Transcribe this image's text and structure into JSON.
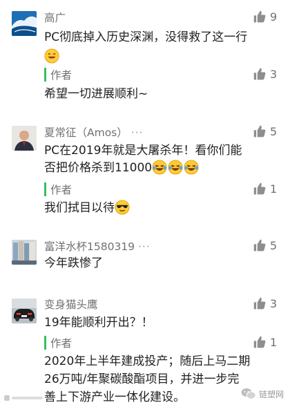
{
  "comments": [
    {
      "name": "高广",
      "likes": "9",
      "text": "PC彻底掉入历史深渊，没得救了这一行",
      "reply": {
        "label": "作者",
        "likes": "3",
        "text": "希望一切进展顺利~"
      }
    },
    {
      "name": "夏常征（Amos）",
      "more": "···",
      "likes": "5",
      "text_line1": "PC在2019年就是大屠杀年！看你们能",
      "text_line2": "否把价格杀到11000",
      "reply": {
        "label": "作者",
        "likes": "1",
        "text": "我们拭目以待"
      }
    },
    {
      "name": "富洋水杯1580319",
      "more": "···",
      "likes": "5",
      "text": "今年跌惨了"
    },
    {
      "name": "变身猫头鹰",
      "likes": "3",
      "text": "19年能顺利开出？！",
      "reply": {
        "label": "作者",
        "likes": "1",
        "line1": "2020年上半年建成投产；随后上马二期",
        "line2": "26万吨/年聚碳酸酯项目，并进一步完",
        "line3": "善上下游产业一体化建设。"
      }
    }
  ],
  "watermarks": {
    "right": "链塑网"
  },
  "colors": {
    "accent_green": "#35c15b",
    "icon_gray": "#8e8e8e"
  },
  "icons": [
    "thumb-up-icon",
    "smile-emoji-icon",
    "laugh-tears-emoji-icon",
    "sunglasses-emoji-icon"
  ]
}
